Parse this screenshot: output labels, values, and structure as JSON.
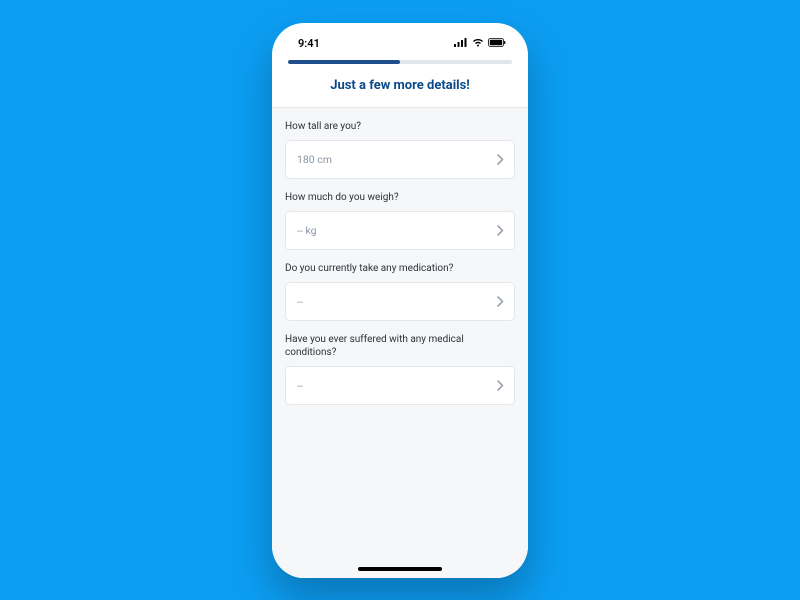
{
  "statusBar": {
    "time": "9:41"
  },
  "header": {
    "title": "Just a few more details!"
  },
  "progress": {
    "percent": 50
  },
  "fields": {
    "height": {
      "label": "How tall are you?",
      "value": "180 cm"
    },
    "weight": {
      "label": "How much do you weigh?",
      "value": "-- kg"
    },
    "medication": {
      "label": "Do you currently take any medication?",
      "value": "--"
    },
    "conditions": {
      "label": "Have you ever suffered with any medical conditions?",
      "value": "--"
    }
  }
}
